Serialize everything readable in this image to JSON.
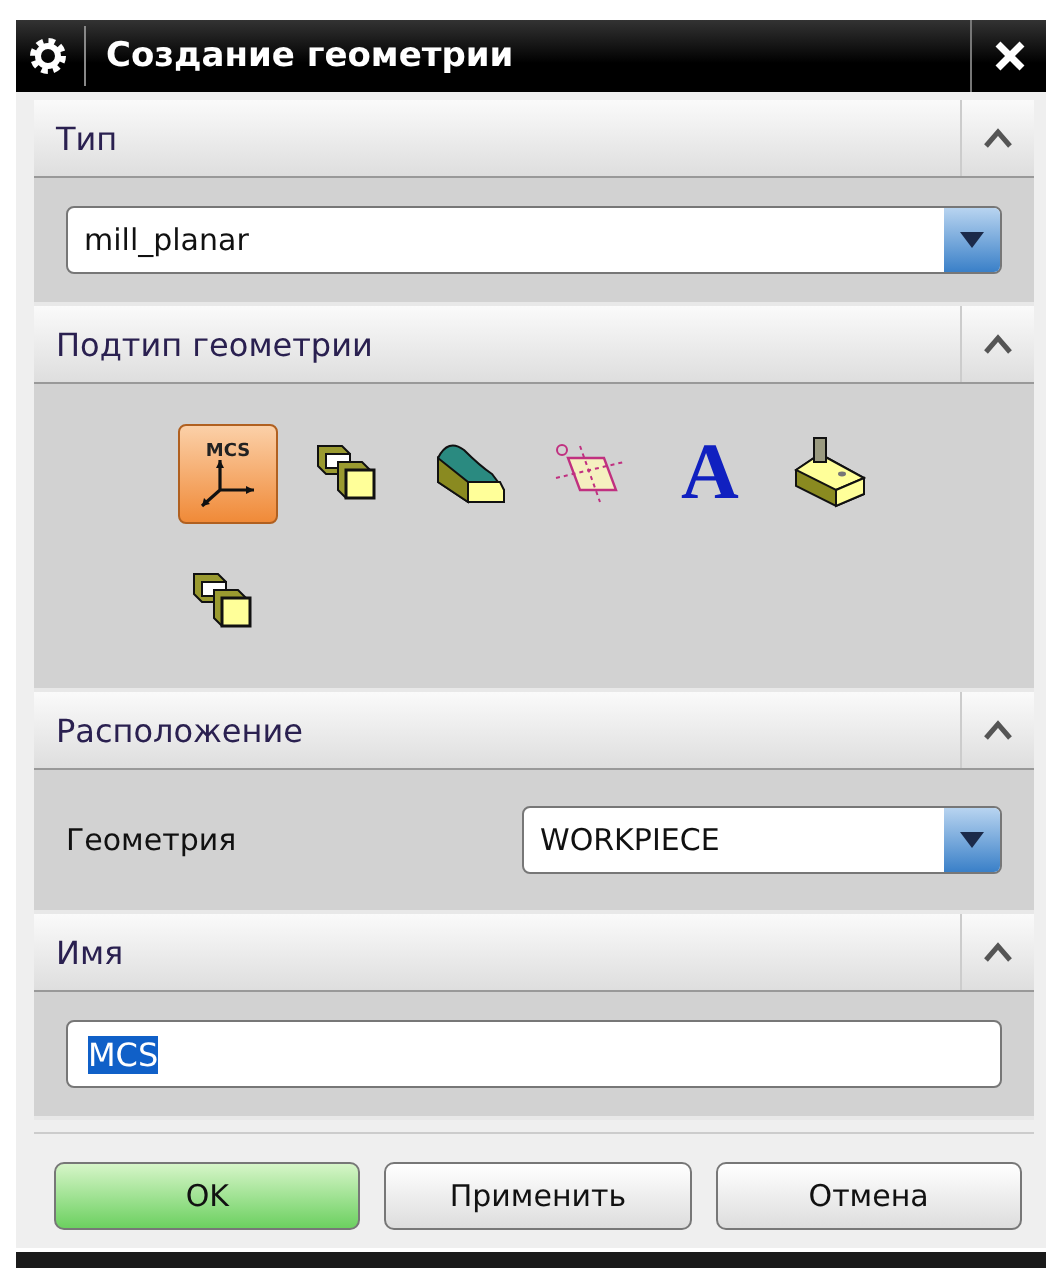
{
  "window": {
    "title": "Создание геометрии"
  },
  "type_section": {
    "title": "Тип",
    "expanded": true,
    "dropdown": {
      "value": "mill_planar"
    }
  },
  "subtype_section": {
    "title": "Подтип геометрии",
    "expanded": true,
    "items": [
      {
        "kind": "mcs",
        "label": "MCS",
        "selected": true
      },
      {
        "kind": "blocks",
        "selected": false
      },
      {
        "kind": "curved",
        "selected": false
      },
      {
        "kind": "plane",
        "selected": false
      },
      {
        "kind": "letter",
        "label": "A",
        "selected": false
      },
      {
        "kind": "pin",
        "selected": false
      },
      {
        "kind": "blocks",
        "selected": false
      }
    ]
  },
  "location_section": {
    "title": "Расположение",
    "expanded": true,
    "field_label": "Геометрия",
    "dropdown": {
      "value": "WORKPIECE"
    }
  },
  "name_section": {
    "title": "Имя",
    "expanded": true,
    "input": {
      "value": "MCS",
      "text_selected": true
    }
  },
  "buttons": [
    {
      "label": "OK",
      "kind": "primary"
    },
    {
      "label": "Применить",
      "kind": "normal"
    },
    {
      "label": "Отмена",
      "kind": "normal"
    }
  ]
}
